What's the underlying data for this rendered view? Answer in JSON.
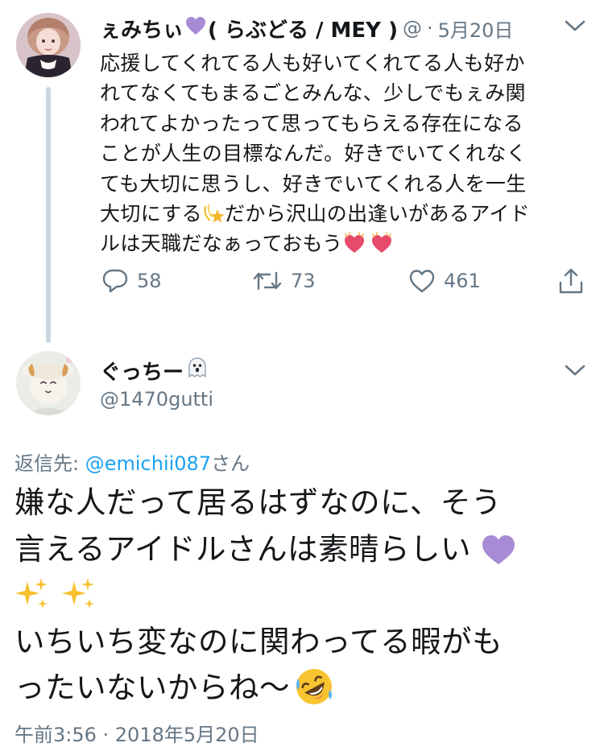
{
  "parent_tweet": {
    "display_name": "ぇみちぃ",
    "name_suffix": "( らぶどる / MEY )",
    "handle_fragment": "@",
    "separator": "·",
    "date": "5月20日",
    "text_lines": [
      "応援してくれてる人も好いてくれてる人も好か",
      "れてなくてもまるごとみんな、少しでもぇみ関",
      "われてよかったって思ってもらえる存在になる",
      "ことが人生の目標なんだ。好きでいてくれなく",
      "ても大切に思うし、好きでいてくれる人を一生",
      "大切にする",
      "だから沢山の出逢いがあるアイド",
      "ルは天職だなぁっておもう"
    ],
    "reply_count": "58",
    "retweet_count": "73",
    "like_count": "461"
  },
  "reply_tweet": {
    "display_name": "ぐっちー",
    "handle": "@1470gutti",
    "reply_prefix": "返信先: ",
    "reply_mention": "@emichii087",
    "reply_suffix": "さん",
    "text_lines": [
      "嫌な人だって居るはずなのに、そう",
      "言えるアイドルさんは素晴らしい",
      "いちいち変なのに関わってる暇がも",
      "ったいないからね〜"
    ],
    "timestamp": "午前3:56 · 2018年5月20日"
  },
  "icons": {
    "name_heart": "purple-heart-icon",
    "dizzy": "dizzy-star-icon",
    "hearts": "growing-heart-icon",
    "ghost": "ghost-icon",
    "sparkles": "sparkles-icon",
    "laugh": "rolling-laughing-icon",
    "menu": "chevron-down-icon",
    "reply": "reply-icon",
    "retweet": "retweet-icon",
    "like": "like-heart-icon",
    "share": "share-icon"
  },
  "colors": {
    "text": "#14171a",
    "secondary": "#657786",
    "link": "#1da1f2",
    "thread_line": "#ccd6dd",
    "purple_heart": "#a78bd4"
  }
}
